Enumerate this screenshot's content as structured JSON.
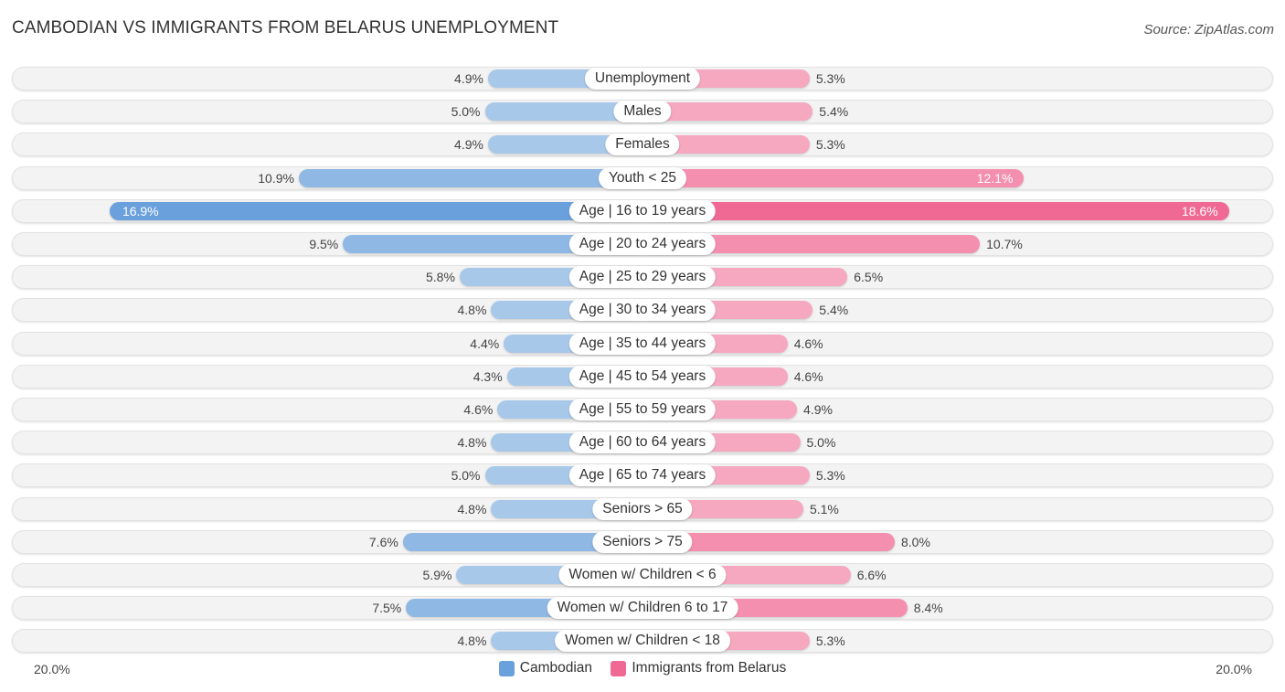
{
  "title": "CAMBODIAN VS IMMIGRANTS FROM BELARUS UNEMPLOYMENT",
  "source": "Source: ZipAtlas.com",
  "chart_data": {
    "type": "bar",
    "orientation": "horizontal-diverging",
    "title": "CAMBODIAN VS IMMIGRANTS FROM BELARUS UNEMPLOYMENT",
    "categories": [
      "Unemployment",
      "Males",
      "Females",
      "Youth < 25",
      "Age | 16 to 19 years",
      "Age | 20 to 24 years",
      "Age | 25 to 29 years",
      "Age | 30 to 34 years",
      "Age | 35 to 44 years",
      "Age | 45 to 54 years",
      "Age | 55 to 59 years",
      "Age | 60 to 64 years",
      "Age | 65 to 74 years",
      "Seniors > 65",
      "Seniors > 75",
      "Women w/ Children < 6",
      "Women w/ Children 6 to 17",
      "Women w/ Children < 18"
    ],
    "series": [
      {
        "name": "Cambodian",
        "color": "#6aa0dc",
        "values": [
          4.9,
          5.0,
          4.9,
          10.9,
          16.9,
          9.5,
          5.8,
          4.8,
          4.4,
          4.3,
          4.6,
          4.8,
          5.0,
          4.8,
          7.6,
          5.9,
          7.5,
          4.8
        ]
      },
      {
        "name": "Immigrants from Belarus",
        "color": "#f06994",
        "values": [
          5.3,
          5.4,
          5.3,
          12.1,
          18.6,
          10.7,
          6.5,
          5.4,
          4.6,
          4.6,
          4.9,
          5.0,
          5.3,
          5.1,
          8.0,
          6.6,
          8.4,
          5.3
        ]
      }
    ],
    "value_format": "{v}%",
    "xlim": [
      -20,
      20
    ],
    "axis_labels": {
      "left": "20.0%",
      "right": "20.0%"
    },
    "legend": {
      "placement": "bottom-center",
      "entries": [
        "Cambodian",
        "Immigrants from Belarus"
      ]
    },
    "grid": false
  }
}
